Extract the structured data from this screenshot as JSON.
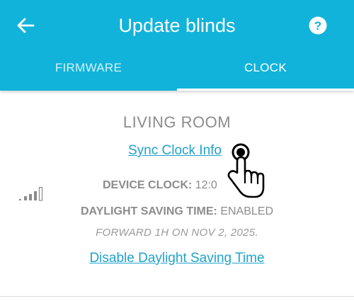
{
  "header": {
    "title": "Update blinds",
    "back_icon": "arrow-left-icon",
    "help_icon": "question-circle-icon",
    "background_color": "#12b3da"
  },
  "tabs": [
    {
      "label": "FIRMWARE",
      "active": false
    },
    {
      "label": "CLOCK",
      "active": true
    }
  ],
  "clock": {
    "room_name": "LIVING ROOM",
    "sync_link": "Sync Clock Info",
    "device_clock_label": "DEVICE CLOCK:",
    "device_clock_value": "12:0",
    "dst_label": "DAYLIGHT SAVING TIME:",
    "dst_value": "ENABLED",
    "forward_note": "FORWARD 1H ON NOV 2, 2025.",
    "disable_link": "Disable Daylight Saving Time",
    "signal_icon": "signal-strength-icon",
    "signal_bars_active": 4,
    "signal_bars_total": 5,
    "link_color": "#1ea3cc"
  },
  "overlay": {
    "cursor_icon": "hand-pointer-icon"
  }
}
